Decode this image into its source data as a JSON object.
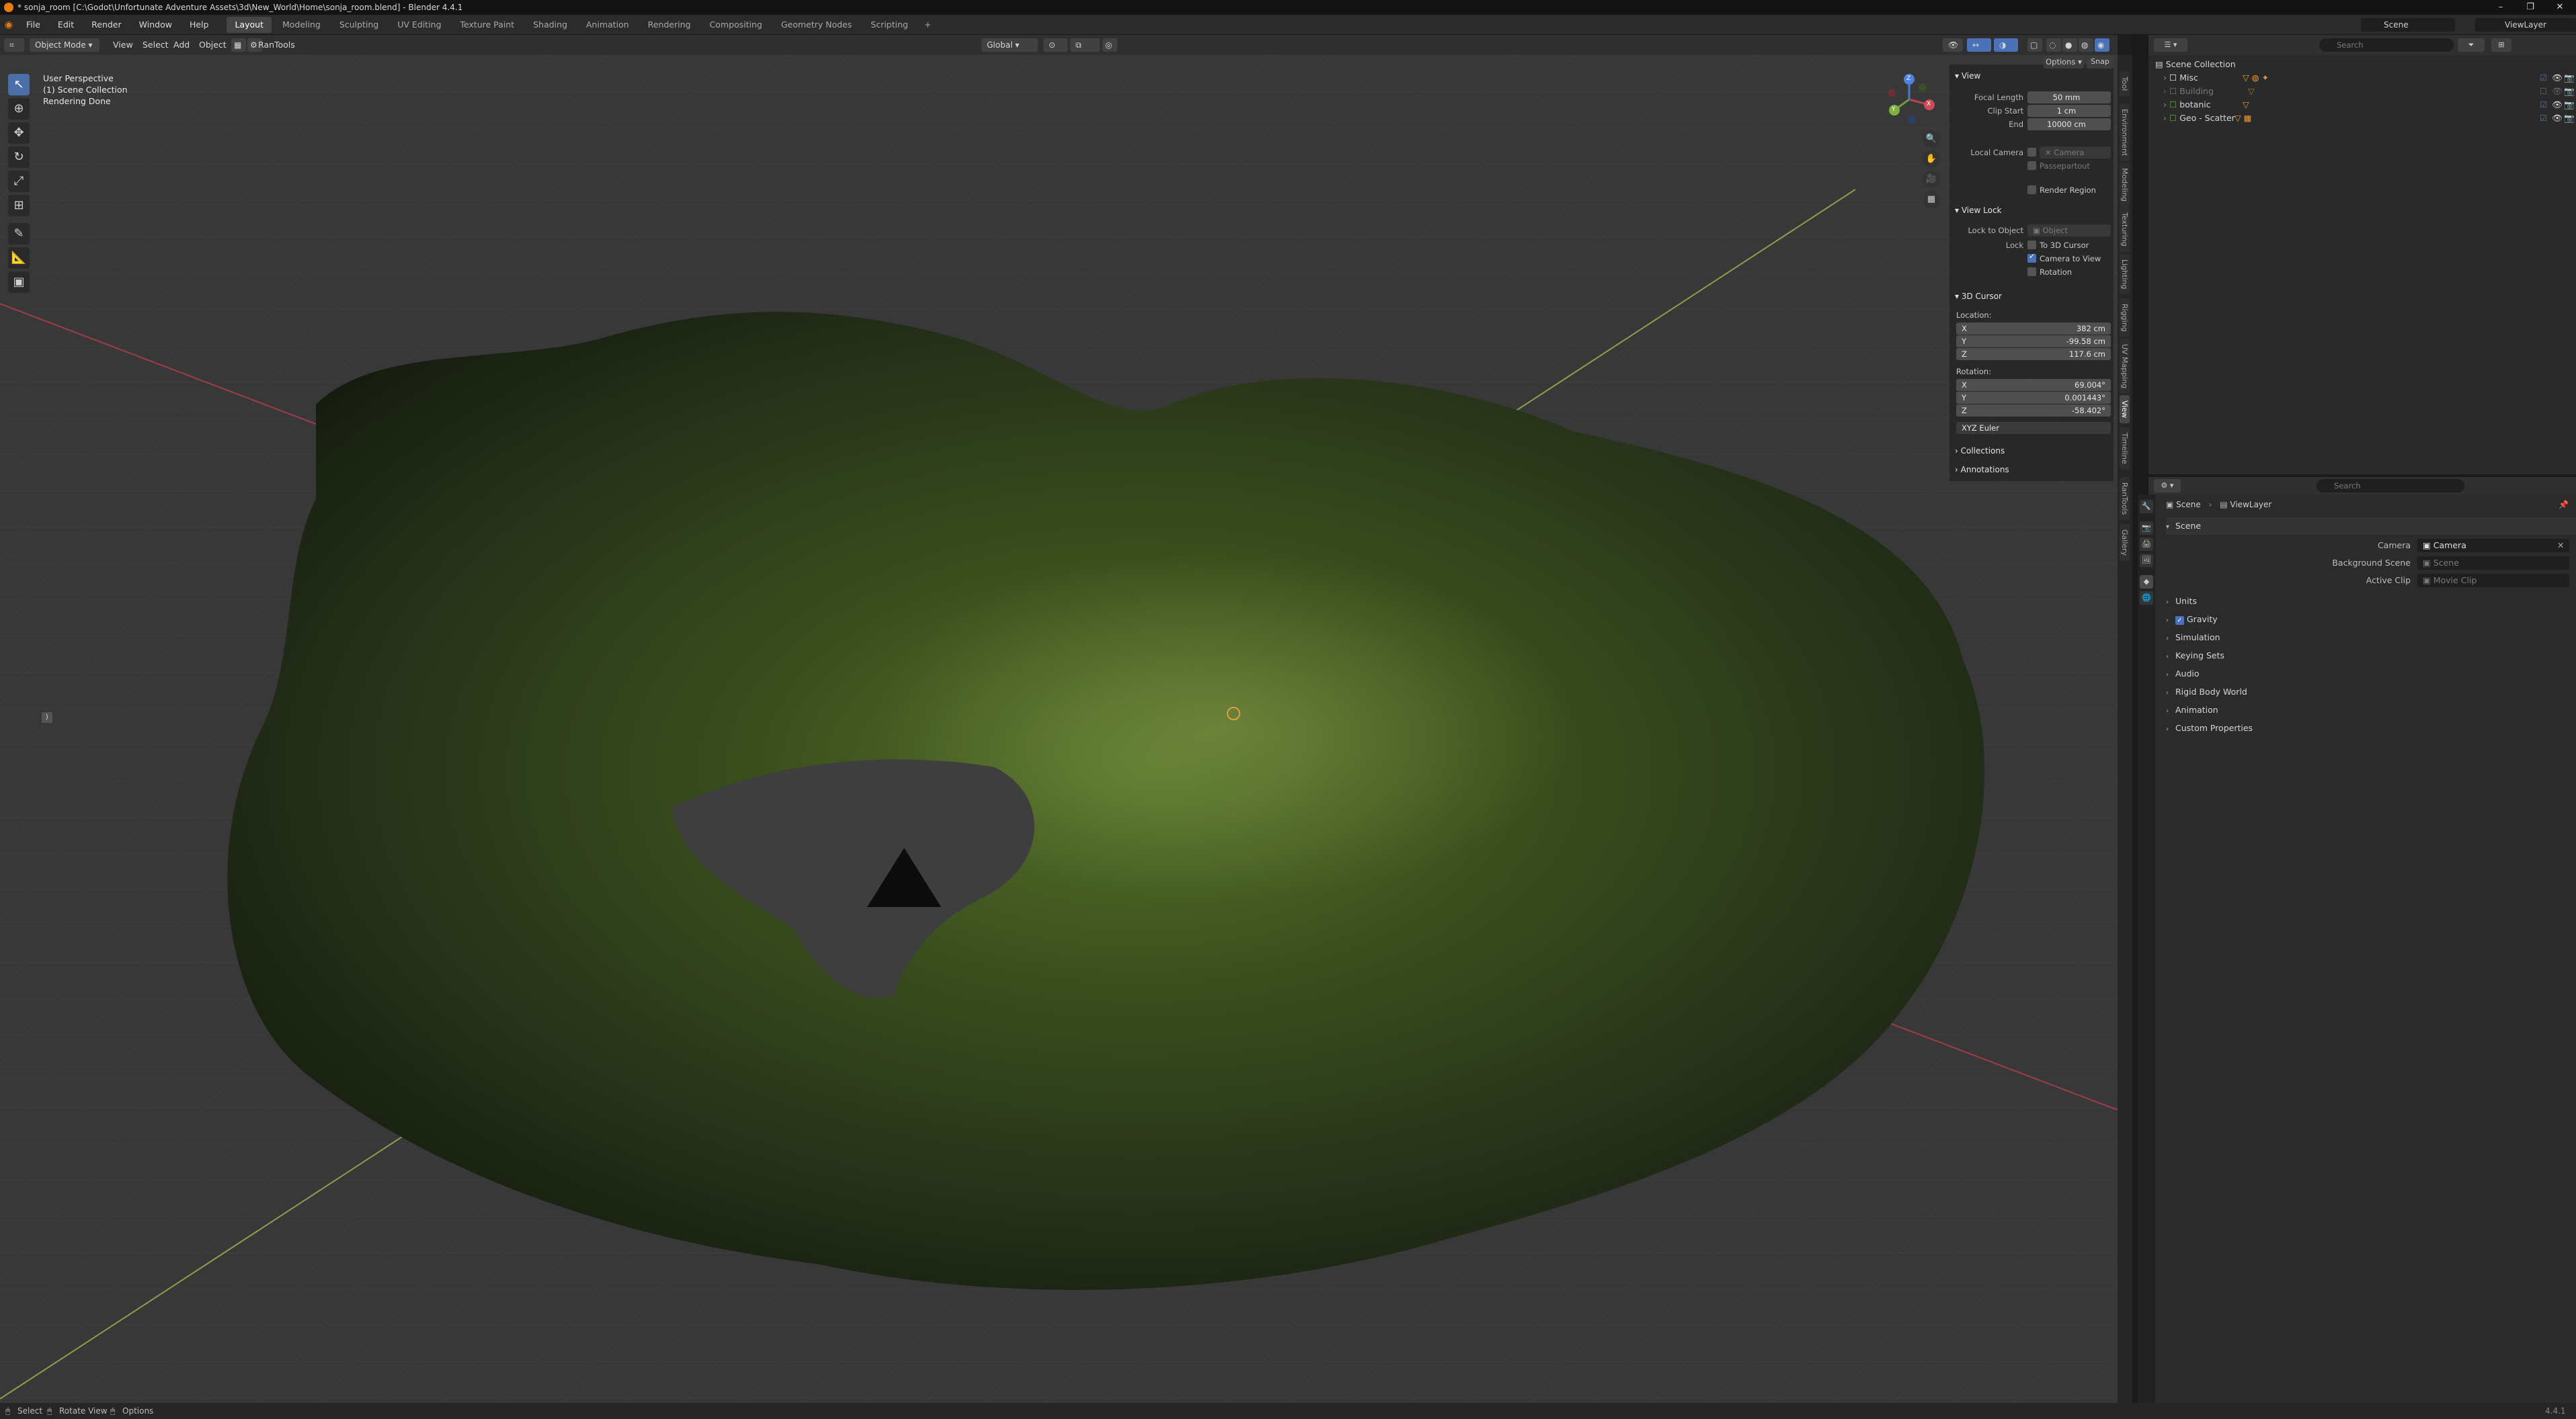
{
  "window": {
    "title": "* sonja_room [C:\\Godot\\Unfortunate Adventure Assets\\3d\\New_World\\Home\\sonja_room.blend] - Blender 4.4.1",
    "controls": [
      "–",
      "❐",
      "✕"
    ]
  },
  "menubar": {
    "menus": [
      "File",
      "Edit",
      "Render",
      "Window",
      "Help"
    ],
    "workspaces": [
      "Layout",
      "Modeling",
      "Sculpting",
      "UV Editing",
      "Texture Paint",
      "Shading",
      "Animation",
      "Rendering",
      "Compositing",
      "Geometry Nodes",
      "Scripting"
    ],
    "active_workspace": "Layout",
    "add_tab": "+",
    "scene_label": "Scene",
    "viewlayer_label": "ViewLayer"
  },
  "viewport_header": {
    "mode": "Object Mode",
    "menus": [
      "View",
      "Select",
      "Add",
      "Object"
    ],
    "addon": "RanTools",
    "orientation": "Global",
    "options": "Options",
    "snap": "Snap"
  },
  "overlay_text": {
    "line1": "User Perspective",
    "line2": "(1) Scene Collection",
    "line3": "Rendering Done"
  },
  "gizmo": {
    "x": "X",
    "y": "Y",
    "z": "Z"
  },
  "npanel": {
    "view_header": "View",
    "focal_length_label": "Focal Length",
    "focal_length": "50 mm",
    "clip_start_label": "Clip Start",
    "clip_start": "1 cm",
    "clip_end_label": "End",
    "clip_end": "10000 cm",
    "local_camera_label": "Local Camera",
    "local_camera_placeholder": "Camera",
    "passepartout": "Passepartout",
    "render_region": "Render Region",
    "view_lock_header": "View Lock",
    "lock_to_object_label": "Lock to Object",
    "lock_to_object_placeholder": "Object",
    "lock_label": "Lock",
    "to_3d_cursor": "To 3D Cursor",
    "camera_to_view": "Camera to View",
    "rotation_lock": "Rotation",
    "cursor_header": "3D Cursor",
    "location_label": "Location:",
    "loc_x": "382 cm",
    "loc_y": "-99.58 cm",
    "loc_z": "117.6 cm",
    "rotation_label": "Rotation:",
    "rot_x": "69.004°",
    "rot_y": "0.001443°",
    "rot_z": "-58.402°",
    "euler": "XYZ Euler",
    "collections": "Collections",
    "annotations": "Annotations",
    "axis_x": "X",
    "axis_y": "Y",
    "axis_z": "Z"
  },
  "sidebar_tabs": [
    "Tool",
    "Environment",
    "Modeling",
    "Texturing",
    "Lighting",
    "Rigging",
    "UV Mapping",
    "View",
    "Timeline",
    "RanTools",
    "Gallery"
  ],
  "sidebar_active_tab": "View",
  "outliner": {
    "root": "Scene Collection",
    "items": [
      {
        "name": "Misc",
        "dim": false
      },
      {
        "name": "Building",
        "dim": true
      },
      {
        "name": "botanic",
        "dim": false
      },
      {
        "name": "Geo - Scatter",
        "dim": false
      }
    ],
    "search_placeholder": "Search"
  },
  "properties": {
    "search_placeholder": "Search",
    "breadcrumb_scene": "Scene",
    "breadcrumb_viewlayer": "ViewLayer",
    "scene_section": "Scene",
    "camera_label": "Camera",
    "camera_value": "Camera",
    "background_scene_label": "Background Scene",
    "background_scene_value": "Scene",
    "active_clip_label": "Active Clip",
    "active_clip_value": "Movie Clip",
    "sections": [
      "Units",
      "Gravity",
      "Simulation",
      "Keying Sets",
      "Audio",
      "Rigid Body World",
      "Animation",
      "Custom Properties"
    ]
  },
  "statusbar": {
    "select": "Select",
    "rotate": "Rotate View",
    "options": "Options",
    "version": "4.4.1"
  },
  "colors": {
    "accent": "#4b72b8",
    "active_tool": "#4b6fa8",
    "axis_red": "#a03c48",
    "axis_green": "#8aa04a",
    "blender_orange": "#e87d0d"
  }
}
